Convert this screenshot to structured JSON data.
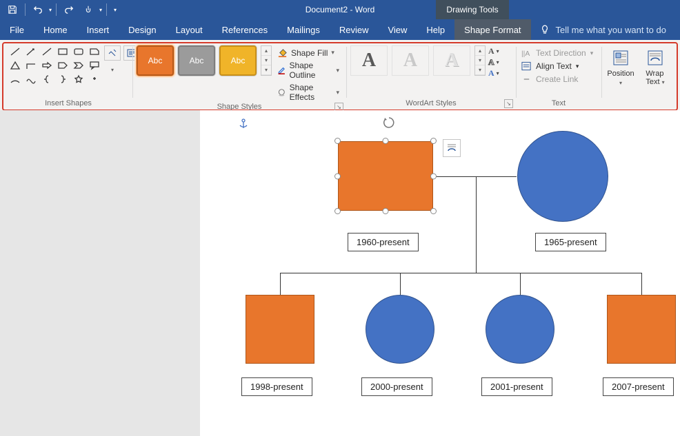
{
  "window": {
    "title": "Document2  -  Word",
    "context_tab": "Drawing Tools"
  },
  "menu": {
    "file": "File",
    "home": "Home",
    "insert": "Insert",
    "design": "Design",
    "layout": "Layout",
    "references": "References",
    "mailings": "Mailings",
    "review": "Review",
    "view": "View",
    "help": "Help",
    "shape_format": "Shape Format",
    "tell_me": "Tell me what you want to do"
  },
  "ribbon": {
    "insert_shapes": {
      "label": "Insert Shapes"
    },
    "shape_styles": {
      "label": "Shape Styles",
      "swatch_text": "Abc",
      "fill": "Shape Fill",
      "outline": "Shape Outline",
      "effects": "Shape Effects"
    },
    "wordart": {
      "label": "WordArt Styles",
      "glyph": "A"
    },
    "text": {
      "label": "Text",
      "direction": "Text Direction",
      "align": "Align Text",
      "link": "Create Link"
    },
    "arrange": {
      "position": "Position",
      "wrap1": "Wrap",
      "wrap2": "Text"
    }
  },
  "canvas": {
    "labels": {
      "p1": "1960-present",
      "p2": "1965-present",
      "c1": "1998-present",
      "c2": "2000-present",
      "c3": "2001-present",
      "c4": "2007-present"
    }
  }
}
